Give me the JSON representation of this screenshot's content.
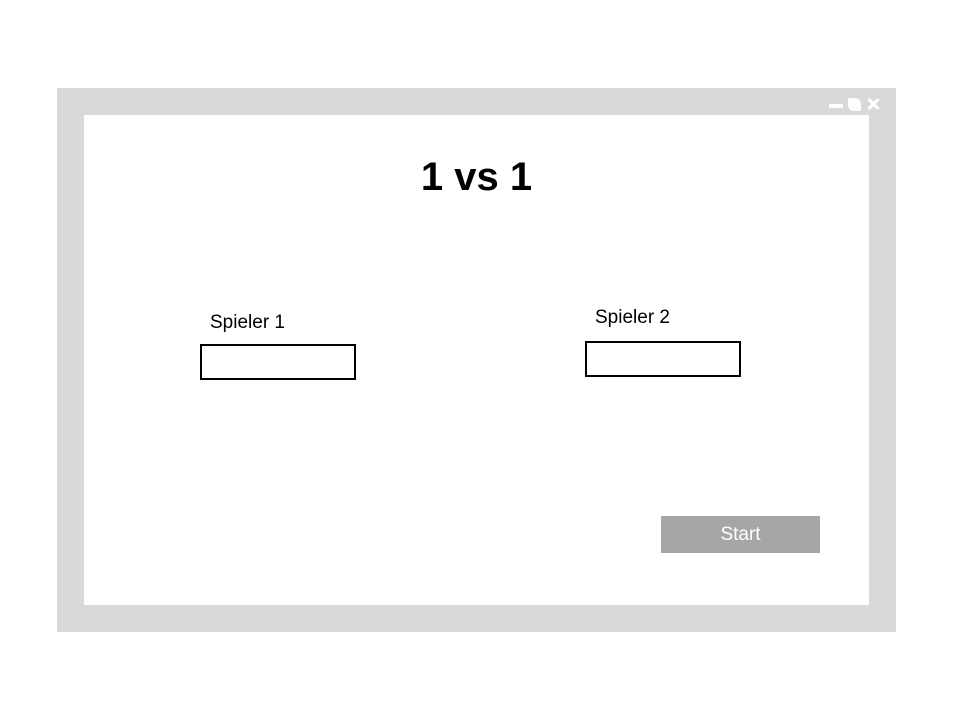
{
  "window": {
    "controls": {
      "minimize_icon": "minimize-icon",
      "maximize_icon": "maximize-icon",
      "close_icon": "close-icon"
    },
    "frame_color": "#d9d9d9",
    "content_color": "#ffffff"
  },
  "main": {
    "title": "1 vs 1",
    "player1": {
      "label": "Spieler 1",
      "value": "",
      "placeholder": ""
    },
    "player2": {
      "label": "Spieler 2",
      "value": "",
      "placeholder": ""
    },
    "start_button": {
      "label": "Start",
      "color": "#a6a6a6"
    }
  }
}
